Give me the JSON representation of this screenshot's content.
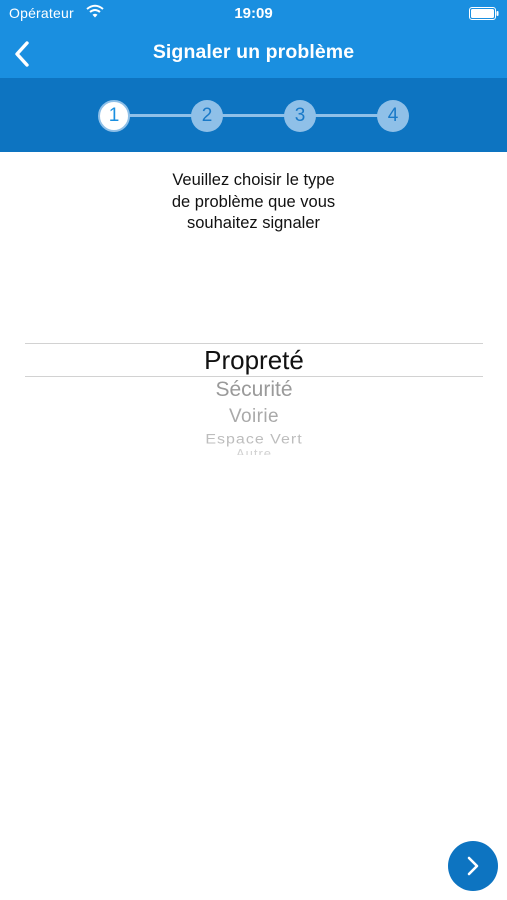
{
  "status_bar": {
    "carrier": "Opérateur",
    "time": "19:09",
    "wifi_icon": "wifi-icon",
    "battery_icon": "battery-icon"
  },
  "nav": {
    "title": "Signaler un problème",
    "back_icon": "chevron-left-icon"
  },
  "steps": {
    "current": 1,
    "items": [
      "1",
      "2",
      "3",
      "4"
    ]
  },
  "instruction": {
    "lines": [
      "Veuillez choisir le type",
      "de problème que vous",
      "souhaitez signaler"
    ]
  },
  "picker": {
    "selected": "Propreté",
    "options": [
      "Propreté",
      "Sécurité",
      "Voirie",
      "Espace Vert",
      "Autre"
    ]
  },
  "next_button": {
    "icon": "chevron-right-icon"
  },
  "colors": {
    "nav_blue": "#1a8fe0",
    "stepper_blue": "#0d74c1",
    "step_inactive": "#8fc0e8",
    "picker_line": "#d2d2d2"
  }
}
